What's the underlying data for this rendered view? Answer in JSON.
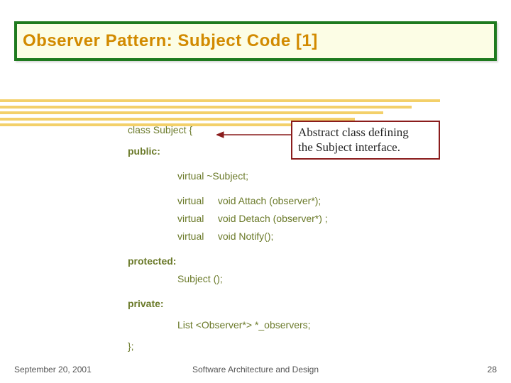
{
  "title": "Observer Pattern: Subject Code [1]",
  "callout": {
    "line1": "Abstract class defining",
    "line2": "the Subject interface."
  },
  "code": {
    "l1": "class Subject {",
    "l2": "public:",
    "l3": "virtual ~Subject;",
    "l4a": "virtual",
    "l4b": "void Attach (observer*);",
    "l5a": "virtual",
    "l5b": "void Detach (observer*) ;",
    "l6a": "virtual",
    "l6b": "void Notify();",
    "l7": "protected:",
    "l8": "Subject ();",
    "l9": "private:",
    "l10": "List <Observer*> *_observers;",
    "l11": "};"
  },
  "footer": {
    "date": "September 20, 2001",
    "center": "Software Architecture and Design",
    "page": "28"
  }
}
